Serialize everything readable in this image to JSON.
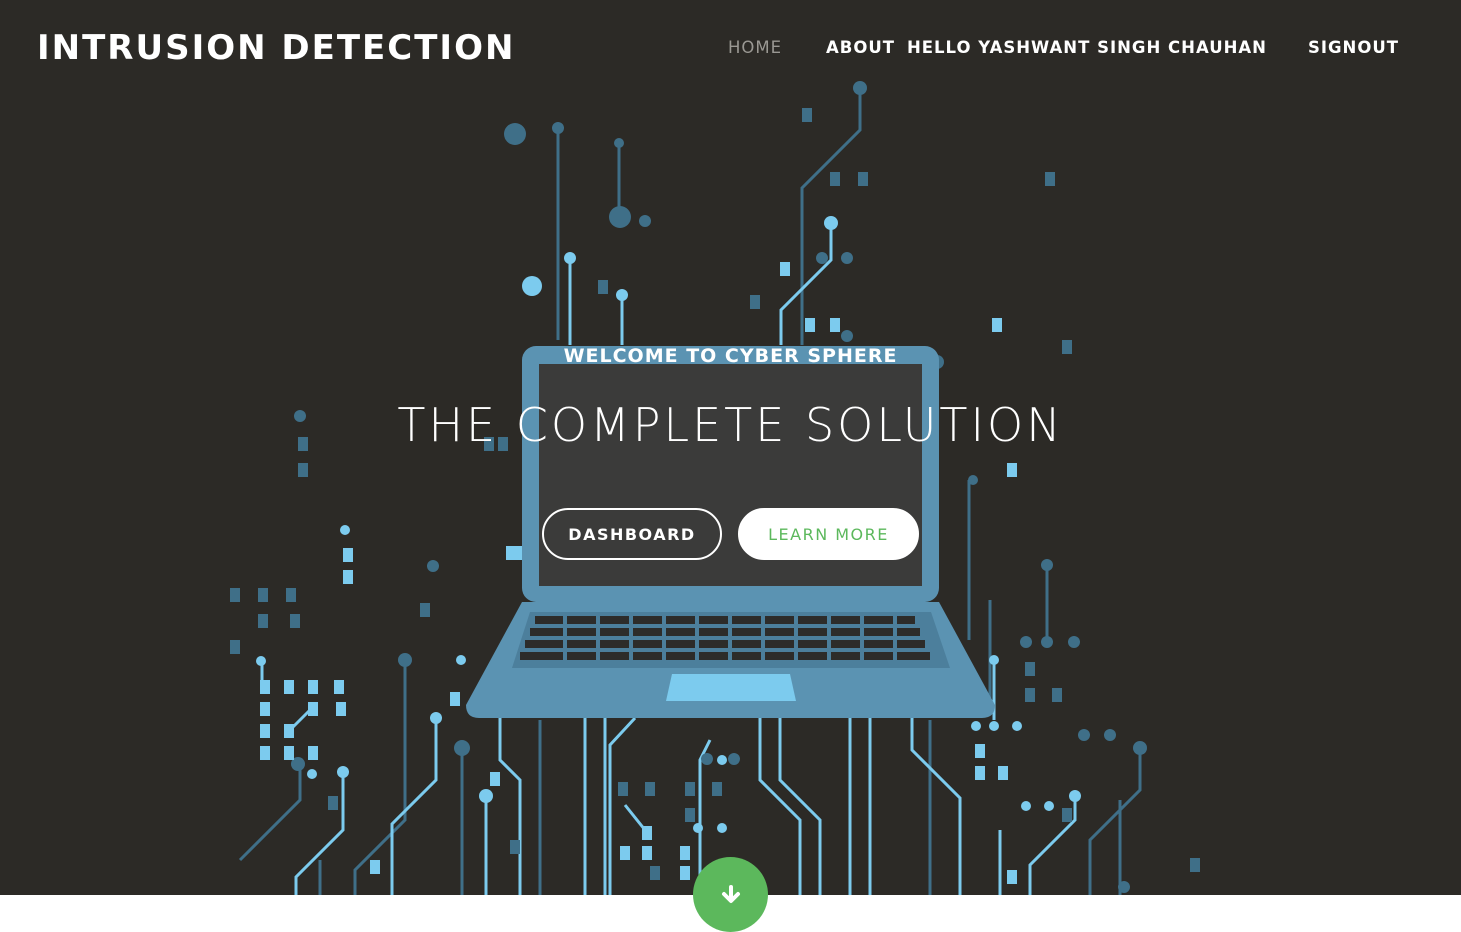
{
  "header": {
    "brand": "INTRUSION DETECTION",
    "nav": [
      {
        "label": "HOME",
        "active": true
      },
      {
        "label": "ABOUT",
        "active": false
      },
      {
        "label": "HELLO YASHWANT SINGH CHAUHAN",
        "active": false
      },
      {
        "label": "SIGNOUT",
        "active": false
      }
    ]
  },
  "hero": {
    "welcome": "WELCOME TO CYBER SPHERE",
    "headline": "THE COMPLETE SOLUTION",
    "buttons": {
      "dashboard": "DASHBOARD",
      "learn_more": "LEARN MORE"
    },
    "scroll_icon": "arrow-down-icon"
  },
  "colors": {
    "background": "#2c2a26",
    "accent_green": "#5cb85c",
    "circuit_light": "#7ccbee",
    "circuit_dark": "#3f6f88",
    "laptop_body": "#5b93b2"
  }
}
